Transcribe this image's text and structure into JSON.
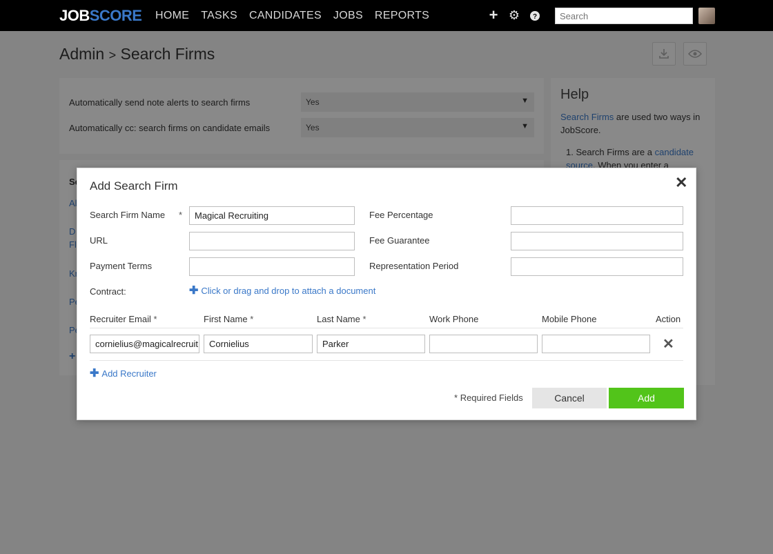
{
  "topnav": {
    "logo_part1": "JOB",
    "logo_part2": "SCORE",
    "items": [
      "HOME",
      "TASKS",
      "CANDIDATES",
      "JOBS",
      "REPORTS"
    ],
    "search_placeholder": "Search",
    "icons": [
      "plus-icon",
      "gear-icon",
      "help-icon"
    ]
  },
  "page": {
    "breadcrumb_root": "Admin",
    "breadcrumb_sep": ">",
    "breadcrumb_current": "Search Firms"
  },
  "settings": [
    {
      "label": "Automatically send note alerts to search firms",
      "value": "Yes"
    },
    {
      "label": "Automatically cc: search firms on candidate emails",
      "value": "Yes"
    }
  ],
  "list_peek": [
    "Se",
    "Al",
    "D",
    "Fl",
    "Kr",
    "Pe",
    "Pe",
    "+"
  ],
  "help": {
    "title": "Help",
    "link1": "Search Firms",
    "text1": " are used two ways in JobScore.",
    "li_prefix": "1. Search Firms are a ",
    "li_link": "candidate source",
    "li_text": ". When you enter a"
  },
  "modal": {
    "title": "Add Search Firm",
    "fields": {
      "firm_name_label": "Search Firm Name",
      "firm_name_value": "Magical Recruiting",
      "url_label": "URL",
      "url_value": "",
      "payment_terms_label": "Payment Terms",
      "payment_terms_value": "",
      "fee_percentage_label": "Fee Percentage",
      "fee_percentage_value": "",
      "fee_guarantee_label": "Fee Guarantee",
      "fee_guarantee_value": "",
      "representation_period_label": "Representation Period",
      "representation_period_value": "",
      "contract_label": "Contract:",
      "attach_text": "Click or drag and drop to attach a document"
    },
    "recruiter_columns": [
      "Recruiter Email",
      "First Name",
      "Last Name",
      "Work Phone",
      "Mobile Phone",
      "Action"
    ],
    "recruiter_row": {
      "email": "cornielius@magicalrecruit",
      "first_name": "Cornielius",
      "last_name": "Parker",
      "work_phone": "",
      "mobile_phone": ""
    },
    "add_recruiter": "Add Recruiter",
    "required_note": "Required Fields",
    "cancel": "Cancel",
    "add": "Add",
    "asterisk": "*"
  }
}
